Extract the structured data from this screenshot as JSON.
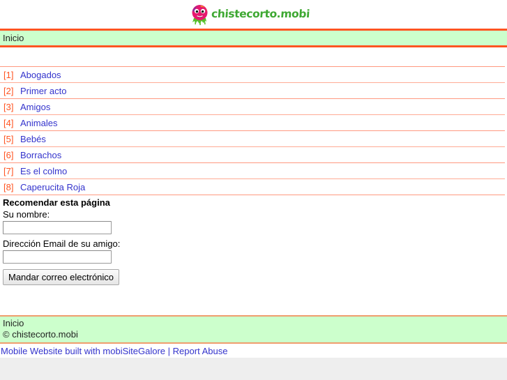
{
  "header": {
    "logo_text": "chistecorto.mobi",
    "logo_icon": "mascot-logo-icon"
  },
  "navbar": {
    "home_label": "Inicio"
  },
  "jokes": {
    "items": [
      {
        "num": "[1]",
        "label": "Abogados"
      },
      {
        "num": "[2]",
        "label": "Primer acto"
      },
      {
        "num": "[3]",
        "label": "Amigos"
      },
      {
        "num": "[4]",
        "label": "Animales"
      },
      {
        "num": "[5]",
        "label": "Bebés"
      },
      {
        "num": "[6]",
        "label": "Borrachos"
      },
      {
        "num": "[7]",
        "label": "Es el colmo"
      },
      {
        "num": "[8]",
        "label": "Caperucita Roja"
      }
    ]
  },
  "recommend_form": {
    "heading": "Recomendar esta página",
    "name_label": "Su nombre:",
    "name_value": "",
    "name_placeholder": "",
    "email_label": "Dirección Email de su amigo:",
    "email_value": "",
    "email_placeholder": "",
    "submit_label": "Mandar correo electrónico"
  },
  "footer": {
    "home_label": "Inicio",
    "copyright": "© chistecorto.mobi",
    "credit_link": "Mobile Website built with mobiSiteGalore",
    "separator": "|",
    "report_link": "Report Abuse"
  },
  "colors": {
    "accent_orange": "#ff5522",
    "divider_orange": "#ff9980",
    "bar_green": "#ccffcc",
    "link_blue": "#3333cc",
    "logo_green": "#3ea832",
    "page_backdrop": "#eeeeee"
  }
}
